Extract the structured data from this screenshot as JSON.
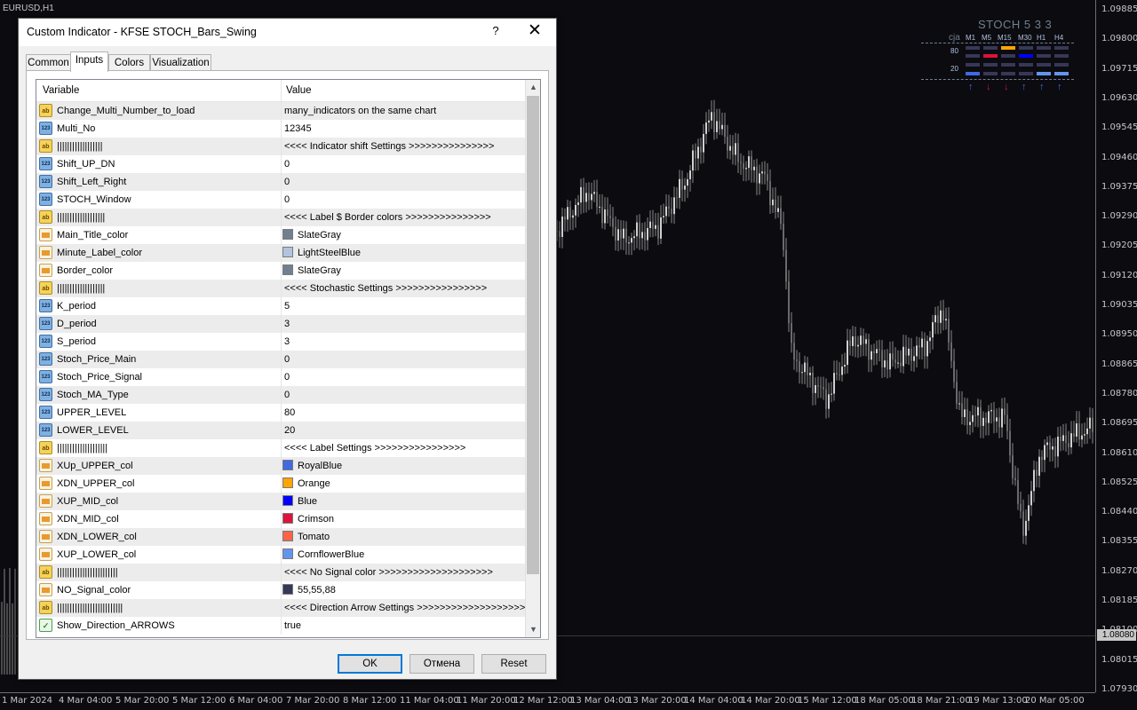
{
  "chart": {
    "symbol": "EURUSD,H1",
    "price_ticks": [
      "1.09885",
      "1.09800",
      "1.09715",
      "1.09630",
      "1.09545",
      "1.09460",
      "1.09375",
      "1.09290",
      "1.09205",
      "1.09120",
      "1.09035",
      "1.08950",
      "1.08865",
      "1.08780",
      "1.08695",
      "1.08610",
      "1.08525",
      "1.08440",
      "1.08355",
      "1.08270",
      "1.08185",
      "1.08100",
      "1.08015",
      "1.07930"
    ],
    "current_price": "1.08080",
    "time_ticks": [
      "1 Mar 2024",
      "4 Mar 04:00",
      "5 Mar 20:00",
      "5 Mar 12:00",
      "6 Mar 04:00",
      "7 Mar 20:00",
      "8 Mar 12:00",
      "11 Mar 04:00",
      "11 Mar 20:00",
      "12 Mar 12:00",
      "13 Mar 04:00",
      "13 Mar 20:00",
      "14 Mar 04:00",
      "14 Mar 20:00",
      "15 Mar 12:00",
      "18 Mar 05:00",
      "18 Mar 21:00",
      "19 Mar 13:00",
      "20 Mar 05:00"
    ]
  },
  "indicator": {
    "title": "STOCH  5 3 3",
    "cja": "cja",
    "timeframes": [
      "M1",
      "M5",
      "M15",
      "M30",
      "H1",
      "H4"
    ],
    "upper_level": "80",
    "lower_level": "20",
    "rows": {
      "upper": [
        "#373758",
        "#373758",
        "#ffa500",
        "#373758",
        "#373758",
        "#373758"
      ],
      "mid": [
        "#373758",
        "#dc143c",
        "#373758",
        "#0000ff",
        "#373758",
        "#373758"
      ],
      "lower": [
        "#373758",
        "#373758",
        "#373758",
        "#373758",
        "#373758",
        "#373758"
      ],
      "bottom": [
        "#4169e1",
        "#373758",
        "#373758",
        "#373758",
        "#6495ed",
        "#6495ed"
      ]
    },
    "arrows": [
      {
        "dir": "↑",
        "color": "#4169e1"
      },
      {
        "dir": "↓",
        "color": "#dc143c"
      },
      {
        "dir": "↓",
        "color": "#dc143c"
      },
      {
        "dir": "↑",
        "color": "#4169e1"
      },
      {
        "dir": "↑",
        "color": "#4169e1"
      },
      {
        "dir": "↑",
        "color": "#4169e1"
      }
    ]
  },
  "dialog": {
    "title": "Custom Indicator - KFSE STOCH_Bars_Swing",
    "help": "?",
    "close": "✕",
    "tabs": [
      "Common",
      "Inputs",
      "Colors",
      "Visualization"
    ],
    "active_tab": "Inputs",
    "headers": {
      "variable": "Variable",
      "value": "Value"
    },
    "params": [
      {
        "type": "ab",
        "name": "Change_Multi_Number_to_load",
        "value": "many_indicators on the same chart"
      },
      {
        "type": "num",
        "name": "Multi_No",
        "value": "12345"
      },
      {
        "type": "ab",
        "name": "||||||||||||||||||",
        "value": "<<<< Indicator shift Settings >>>>>>>>>>>>>>>"
      },
      {
        "type": "num",
        "name": "Shift_UP_DN",
        "value": "0"
      },
      {
        "type": "num",
        "name": "Shift_Left_Right",
        "value": "0"
      },
      {
        "type": "num",
        "name": "STOCH_Window",
        "value": "0"
      },
      {
        "type": "ab",
        "name": "|||||||||||||||||||",
        "value": "<<<< Label $ Border colors >>>>>>>>>>>>>>>"
      },
      {
        "type": "col",
        "name": "Main_Title_color",
        "value": "SlateGray",
        "swatch": "#708090"
      },
      {
        "type": "col",
        "name": "Minute_Label_color",
        "value": "LightSteelBlue",
        "swatch": "#b0c4de"
      },
      {
        "type": "col",
        "name": "Border_color",
        "value": "SlateGray",
        "swatch": "#708090"
      },
      {
        "type": "ab",
        "name": "|||||||||||||||||||",
        "value": "<<<< Stochastic Settings >>>>>>>>>>>>>>>>"
      },
      {
        "type": "num",
        "name": "K_period",
        "value": "5"
      },
      {
        "type": "num",
        "name": "D_period",
        "value": "3"
      },
      {
        "type": "num",
        "name": "S_period",
        "value": "3"
      },
      {
        "type": "num",
        "name": "Stoch_Price_Main",
        "value": "0"
      },
      {
        "type": "num",
        "name": "Stoch_Price_Signal",
        "value": "0"
      },
      {
        "type": "num",
        "name": "Stoch_MA_Type",
        "value": "0"
      },
      {
        "type": "num",
        "name": "UPPER_LEVEL",
        "value": "80"
      },
      {
        "type": "num",
        "name": "LOWER_LEVEL",
        "value": "20"
      },
      {
        "type": "ab",
        "name": "||||||||||||||||||||",
        "value": "<<<< Label Settings >>>>>>>>>>>>>>>>"
      },
      {
        "type": "col",
        "name": "XUp_UPPER_col",
        "value": "RoyalBlue",
        "swatch": "#4169e1"
      },
      {
        "type": "col",
        "name": "XDN_UPPER_col",
        "value": "Orange",
        "swatch": "#ffa500"
      },
      {
        "type": "col",
        "name": "XUP_MID_col",
        "value": "Blue",
        "swatch": "#0000ff"
      },
      {
        "type": "col",
        "name": "XDN_MID_col",
        "value": "Crimson",
        "swatch": "#dc143c"
      },
      {
        "type": "col",
        "name": "XDN_LOWER_col",
        "value": "Tomato",
        "swatch": "#ff6347"
      },
      {
        "type": "col",
        "name": "XUP_LOWER_col",
        "value": "CornflowerBlue",
        "swatch": "#6495ed"
      },
      {
        "type": "ab",
        "name": "||||||||||||||||||||||||",
        "value": "<<<< No Signal color >>>>>>>>>>>>>>>>>>>>"
      },
      {
        "type": "col",
        "name": "NO_Signal_color",
        "value": "55,55,88",
        "swatch": "#373758"
      },
      {
        "type": "ab",
        "name": "||||||||||||||||||||||||||",
        "value": "<<<< Direction Arrow Settings >>>>>>>>>>>>>>>>>>>>>"
      },
      {
        "type": "bool",
        "name": "Show_Direction_ARROWS",
        "value": "true"
      }
    ],
    "buttons": {
      "ok": "OK",
      "cancel": "Отмена",
      "reset": "Reset"
    }
  }
}
